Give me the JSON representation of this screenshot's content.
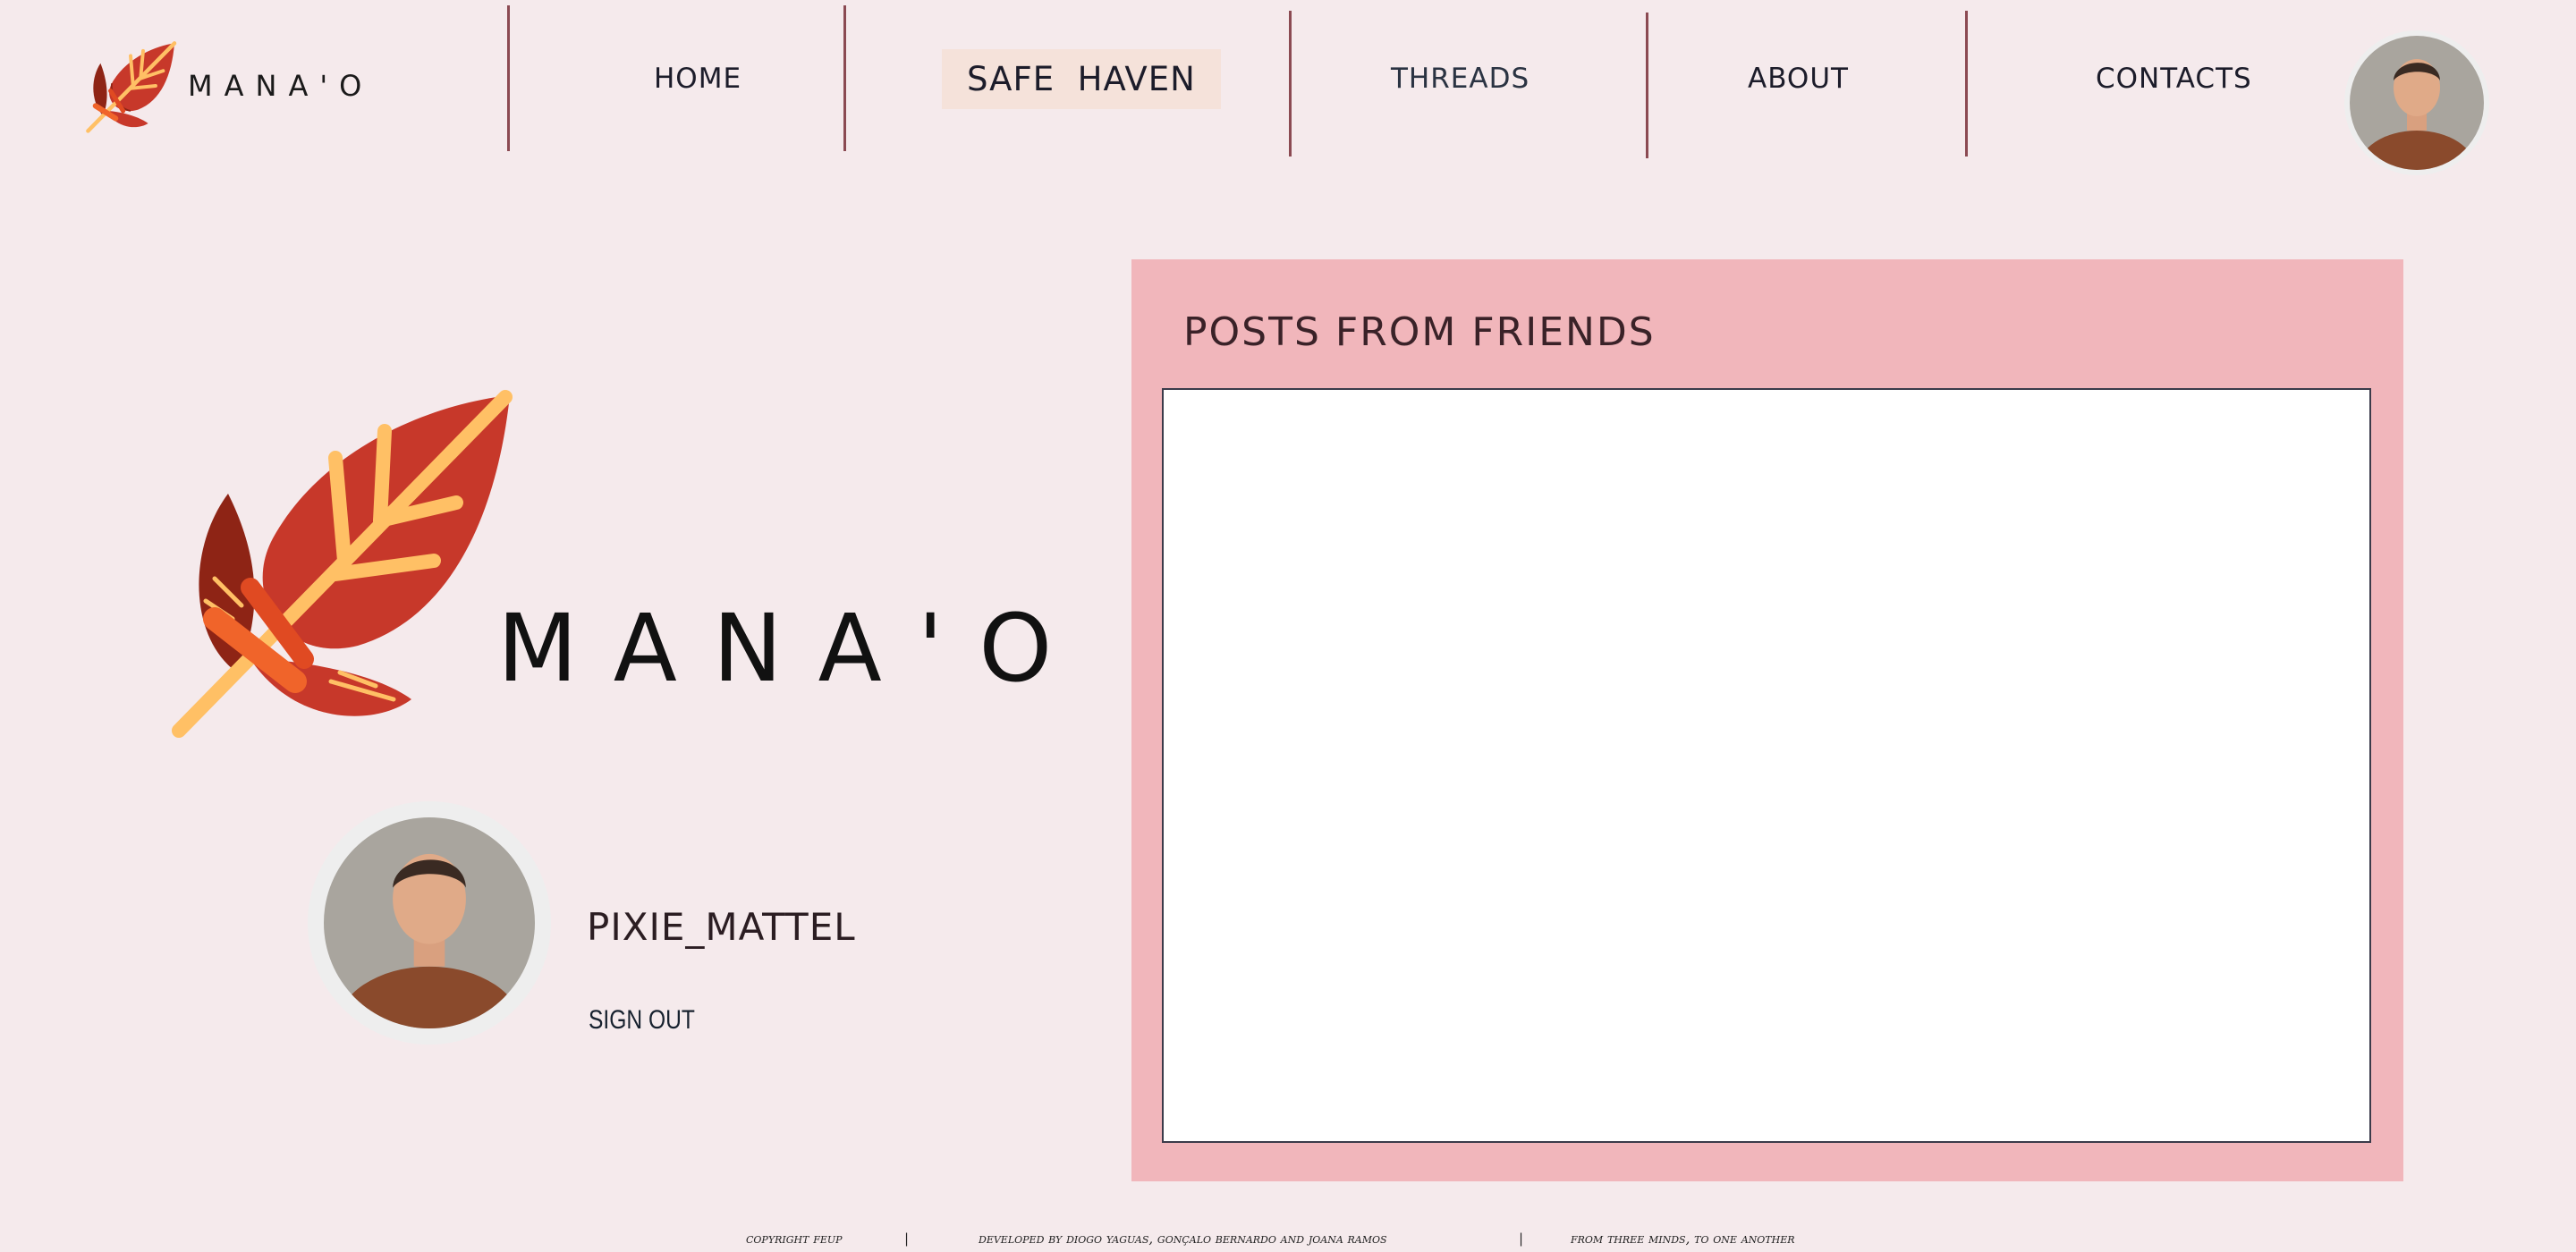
{
  "brand": {
    "name": "MANA'O",
    "colors": {
      "background": "#f5eaec",
      "accent_panel": "#f1b6bb",
      "active_nav": "#f5e2da",
      "divider": "#8b4a52",
      "feather_red": "#c7382a",
      "feather_dark": "#8e2415",
      "feather_orange": "#f0642a",
      "feather_yellow": "#ffc065"
    }
  },
  "nav": {
    "items": [
      {
        "label": "HOME"
      },
      {
        "label": "SAFE  HAVEN",
        "active": true
      },
      {
        "label": "THREADS"
      },
      {
        "label": "ABOUT"
      },
      {
        "label": "CONTACTS"
      }
    ]
  },
  "profile": {
    "username": "PIXIE_MATTEL",
    "sign_out_label": "SIGN OUT",
    "avatar_icon": "user-avatar-photo"
  },
  "posts": {
    "title": "POSTS FROM FRIENDS"
  },
  "footer": {
    "copyright": "copyright feup",
    "separator": "|",
    "developers": "developed by diogo yaguas, gonçalo bernardo and joana ramos",
    "tagline": "from three minds, to one another"
  }
}
